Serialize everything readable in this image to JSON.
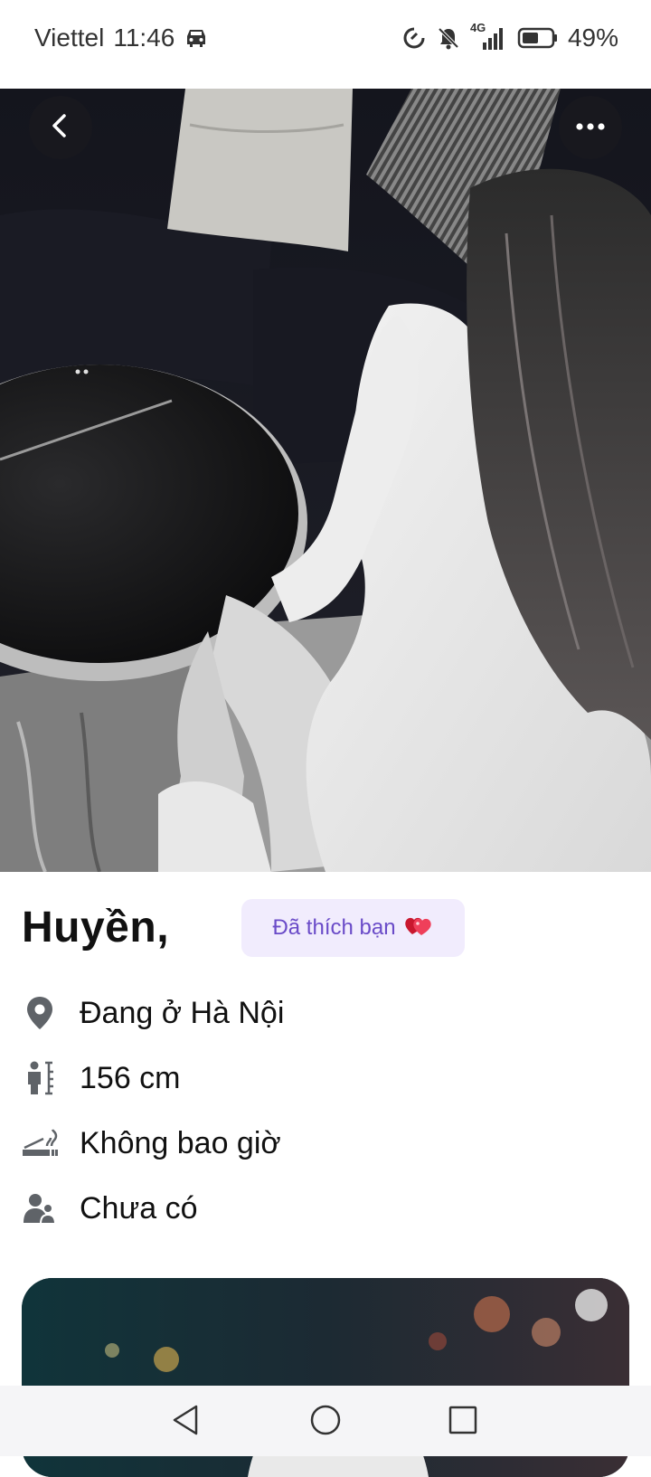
{
  "status_bar": {
    "carrier": "Viettel",
    "time": "11:46",
    "network": "4G",
    "battery_percent": "49%",
    "battery_level": 0.49,
    "icons": [
      "car-icon",
      "data-saver-icon",
      "bell-off-icon",
      "signal-icon",
      "battery-icon"
    ]
  },
  "hero": {
    "icons": [
      "back-icon",
      "more-icon"
    ]
  },
  "profile": {
    "name": "Huyền,",
    "liked_badge": "Đã thích bạn",
    "badge_icon": "heart-icon",
    "info": [
      {
        "icon": "location-icon",
        "text": "Đang ở Hà Nội"
      },
      {
        "icon": "height-icon",
        "text": "156 cm"
      },
      {
        "icon": "smoking-icon",
        "text": "Không bao giờ"
      },
      {
        "icon": "kids-icon",
        "text": "Chưa có"
      }
    ]
  },
  "nav_bar": {
    "buttons": [
      "nav-back-icon",
      "nav-home-icon",
      "nav-recents-icon"
    ]
  },
  "colors": {
    "badge_bg": "#f1ecfd",
    "badge_text": "#6a4bc8",
    "heart": "#e8324a",
    "text": "#111111",
    "icon_gray": "#5f6368"
  }
}
